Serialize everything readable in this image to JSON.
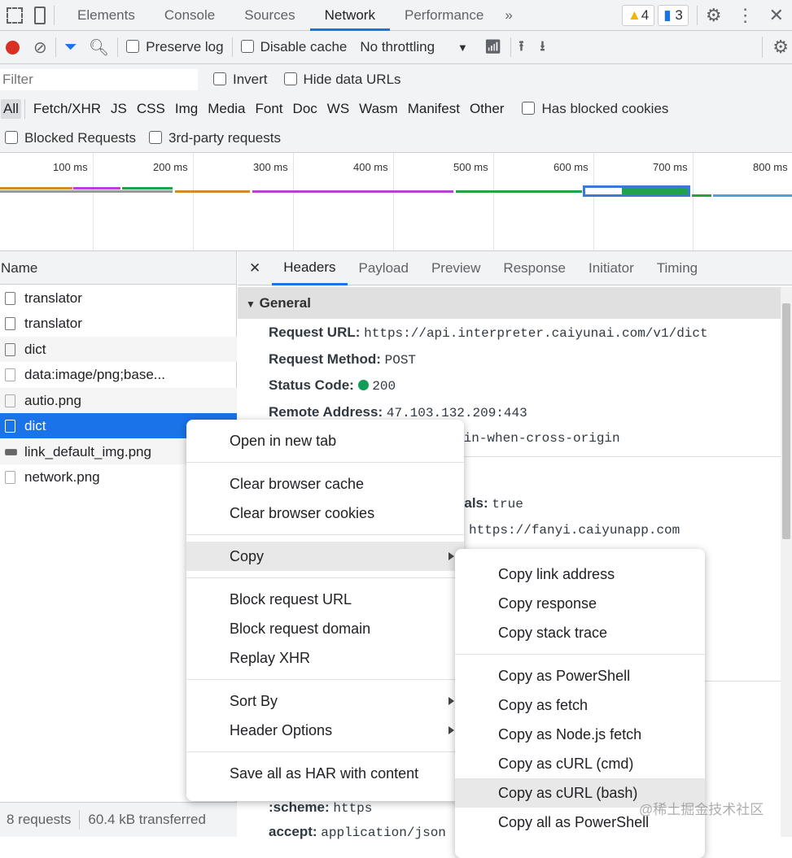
{
  "top_tabs": [
    "Elements",
    "Console",
    "Sources",
    "Network",
    "Performance"
  ],
  "badges": {
    "warnings": "4",
    "messages": "3"
  },
  "toolbar": {
    "preserve_log": "Preserve log",
    "disable_cache": "Disable cache",
    "throttling": "No throttling"
  },
  "filter": {
    "placeholder": "Filter",
    "invert": "Invert",
    "hide_data_urls": "Hide data URLs"
  },
  "types": [
    "All",
    "Fetch/XHR",
    "JS",
    "CSS",
    "Img",
    "Media",
    "Font",
    "Doc",
    "WS",
    "Wasm",
    "Manifest",
    "Other"
  ],
  "has_blocked_cookies": "Has blocked cookies",
  "blocked_requests": "Blocked Requests",
  "third_party": "3rd-party requests",
  "timeline_ticks": [
    "100 ms",
    "200 ms",
    "300 ms",
    "400 ms",
    "500 ms",
    "600 ms",
    "700 ms",
    "800 ms"
  ],
  "name_header": "Name",
  "requests": [
    "translator",
    "translator",
    "dict",
    "data:image/png;base...",
    "autio.png",
    "dict",
    "link_default_img.png",
    "network.png"
  ],
  "status": {
    "requests": "8 requests",
    "transferred": "60.4 kB transferred"
  },
  "detail_tabs": [
    "Headers",
    "Payload",
    "Preview",
    "Response",
    "Initiator",
    "Timing"
  ],
  "general": {
    "title": "General",
    "fields": [
      {
        "k": "Request URL:",
        "v": "https://api.interpreter.caiyunai.com/v1/dict"
      },
      {
        "k": "Request Method:",
        "v": "POST"
      },
      {
        "k": "Status Code:",
        "v": "200"
      },
      {
        "k": "Remote Address:",
        "v": "47.103.132.209:443"
      }
    ],
    "referrer_partial": "gin-when-cross-origin",
    "credentials_key_partial": "tials:",
    "credentials_val": "true",
    "origin_partial": "https://fanyi.caiyunapp.com",
    "scheme_key": ":scheme:",
    "scheme_val": "https",
    "accept_key": "accept:",
    "accept_val": "application/json"
  },
  "context_menu": {
    "groups": [
      [
        "Open in new tab"
      ],
      [
        "Clear browser cache",
        "Clear browser cookies"
      ],
      [
        "Copy"
      ],
      [
        "Block request URL",
        "Block request domain",
        "Replay XHR"
      ],
      [
        "Sort By",
        "Header Options"
      ],
      [
        "Save all as HAR with content"
      ]
    ]
  },
  "copy_submenu": {
    "groups": [
      [
        "Copy link address",
        "Copy response",
        "Copy stack trace"
      ],
      [
        "Copy as PowerShell",
        "Copy as fetch",
        "Copy as Node.js fetch",
        "Copy as cURL (cmd)",
        "Copy as cURL (bash)",
        "Copy all as PowerShell"
      ]
    ]
  },
  "watermark": "@稀土掘金技术社区",
  "colors": {
    "accent": "#1a73e8",
    "record": "#d93025",
    "status_ok": "#0f9d58"
  }
}
